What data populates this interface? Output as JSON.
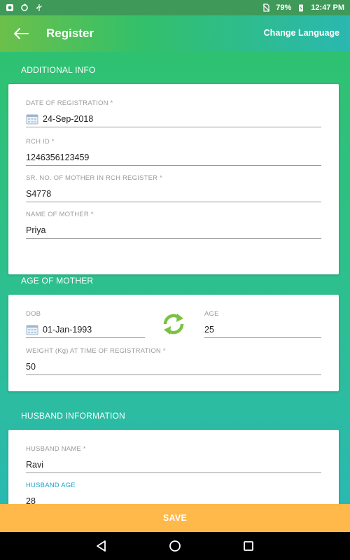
{
  "statusbar": {
    "battery": "79%",
    "time": "12:47 PM"
  },
  "appbar": {
    "title": "Register",
    "change_language": "Change Language"
  },
  "sections": {
    "additional_info": "ADDITIONAL INFO",
    "age_of_mother": "AGE OF MOTHER",
    "husband_info": "HUSBAND INFORMATION"
  },
  "additional": {
    "date_label": "DATE OF REGISTRATION *",
    "date_value": "24-Sep-2018",
    "rch_label": "RCH ID *",
    "rch_value": "1246356123459",
    "srno_label": "SR. NO. OF MOTHER IN RCH REGISTER *",
    "srno_value": "S4778",
    "mother_label": "NAME OF MOTHER *",
    "mother_value": "Priya"
  },
  "age": {
    "dob_label": "DOB",
    "dob_value": "01-Jan-1993",
    "age_label": "AGE",
    "age_value": "25",
    "weight_label": "WEIGHT (Kg) AT TIME OF REGISTRATION *",
    "weight_value": "50"
  },
  "husband": {
    "name_label": "HUSBAND NAME *",
    "name_value": "Ravi",
    "age_label": "HUSBAND AGE",
    "age_value": "28"
  },
  "save_label": "SAVE",
  "colors": {
    "accent": "#1aa3c8",
    "save": "#ffb84a",
    "refresh": "#7cc242"
  }
}
